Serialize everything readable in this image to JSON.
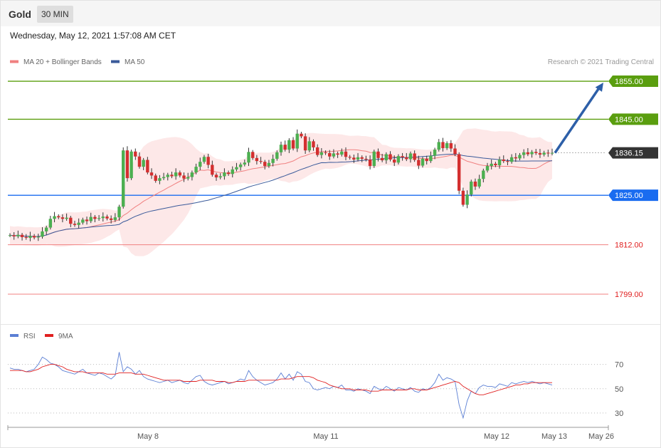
{
  "header": {
    "symbol": "Gold",
    "timeframe": "30 MIN",
    "datetime": "Wednesday, May 12, 2021 1:57:08 AM CET"
  },
  "legend": {
    "ma20": "MA 20 + Bollinger Bands",
    "ma50": "MA 50",
    "copyright": "Research © 2021 Trading Central",
    "ma20_color": "#f08080",
    "ma50_color": "#3a5a9a"
  },
  "rsi_legend": {
    "rsi": "RSI",
    "ma": "9MA",
    "rsi_color": "#5b7fd4",
    "ma_color": "#e02020"
  },
  "colors": {
    "up": "#4caf50",
    "down": "#d32f2f",
    "resistance": "#5a9e0f",
    "support": "#1a6cf0",
    "stop": "#e02020",
    "arrow": "#2d5fa8"
  },
  "chart_data": {
    "type": "candlestick",
    "x_ticks": [
      "May 8",
      "May 11",
      "May 12",
      "May 13",
      "May 26"
    ],
    "ylim": [
      1793,
      1858
    ],
    "levels": [
      {
        "label": "1855.00",
        "value": 1855.0,
        "kind": "resistance"
      },
      {
        "label": "1845.00",
        "value": 1845.0,
        "kind": "resistance"
      },
      {
        "label": "1836.15",
        "value": 1836.15,
        "kind": "current"
      },
      {
        "label": "1825.00",
        "value": 1825.0,
        "kind": "support"
      },
      {
        "label": "1812.00",
        "value": 1812.0,
        "kind": "stop"
      },
      {
        "label": "1799.00",
        "value": 1799.0,
        "kind": "stop"
      }
    ],
    "forecast_arrow": {
      "from": 1836.15,
      "to": 1855.0
    },
    "price_path": [
      1814.5,
      1814.2,
      1814.6,
      1814.0,
      1813.8,
      1814.3,
      1813.9,
      1814.1,
      1815.5,
      1816.5,
      1818.8,
      1819.5,
      1819.2,
      1818.8,
      1819.1,
      1817.5,
      1817.2,
      1817.8,
      1818.6,
      1818.2,
      1819.3,
      1818.8,
      1819.0,
      1819.4,
      1818.9,
      1818.5,
      1819.2,
      1822.0,
      1836.8,
      1829.5,
      1836.5,
      1835.2,
      1832.5,
      1834.3,
      1831.0,
      1830.2,
      1828.8,
      1829.5,
      1829.8,
      1830.4,
      1830.0,
      1831.0,
      1830.2,
      1829.4,
      1829.8,
      1831.0,
      1832.5,
      1833.8,
      1835.1,
      1833.0,
      1830.4,
      1829.7,
      1830.0,
      1831.0,
      1830.6,
      1831.8,
      1832.4,
      1833.1,
      1833.6,
      1836.4,
      1834.8,
      1834.0,
      1833.8,
      1832.7,
      1833.5,
      1834.6,
      1836.3,
      1838.3,
      1837.0,
      1839.5,
      1837.3,
      1841.2,
      1840.5,
      1836.8,
      1839.2,
      1837.6,
      1835.6,
      1836.3,
      1836.1,
      1835.2,
      1836.0,
      1835.7,
      1836.5,
      1835.1,
      1834.9,
      1834.4,
      1835.0,
      1834.6,
      1834.4,
      1832.7,
      1836.5,
      1834.8,
      1834.2,
      1835.8,
      1834.4,
      1833.6,
      1835.3,
      1835.0,
      1834.5,
      1836.0,
      1834.3,
      1832.8,
      1834.6,
      1834.0,
      1835.4,
      1837.0,
      1839.0,
      1837.4,
      1838.7,
      1837.3,
      1835.8,
      1826.2,
      1822.5,
      1825.2,
      1828.6,
      1827.3,
      1829.3,
      1831.5,
      1832.7,
      1833.3,
      1832.9,
      1834.4,
      1834.0,
      1833.8,
      1835.0,
      1834.7,
      1835.6,
      1836.3,
      1835.8,
      1836.4,
      1836.1,
      1835.7,
      1836.2,
      1836.0,
      1836.15
    ],
    "rsi": {
      "ticks": [
        30,
        50,
        70
      ],
      "ylim": [
        20,
        85
      ],
      "path": [
        67,
        66,
        66,
        65,
        64,
        65,
        66,
        70,
        76,
        74,
        71,
        70,
        68,
        65,
        64,
        63,
        62,
        64,
        66,
        63,
        62,
        61,
        63,
        62,
        60,
        58,
        61,
        80,
        64,
        68,
        66,
        62,
        65,
        60,
        58,
        57,
        56,
        55,
        56,
        57,
        55,
        56,
        57,
        55,
        54,
        57,
        60,
        61,
        56,
        54,
        53,
        54,
        55,
        56,
        54,
        55,
        56,
        58,
        57,
        65,
        60,
        57,
        55,
        53,
        54,
        55,
        58,
        63,
        58,
        62,
        57,
        64,
        62,
        56,
        55,
        50,
        49,
        50,
        51,
        50,
        52,
        51,
        53,
        49,
        49,
        48,
        50,
        49,
        48,
        46,
        52,
        50,
        49,
        52,
        50,
        48,
        51,
        50,
        49,
        51,
        48,
        47,
        50,
        49,
        51,
        55,
        62,
        57,
        59,
        58,
        56,
        37,
        26,
        40,
        48,
        46,
        51,
        53,
        52,
        52,
        51,
        54,
        53,
        52,
        55,
        54,
        55,
        56,
        55,
        56,
        55,
        54,
        55,
        54,
        53
      ],
      "ma": [
        65,
        65,
        65,
        65,
        64,
        64,
        65,
        66,
        68,
        69,
        70,
        70,
        69,
        68,
        66,
        65,
        64,
        64,
        64,
        63,
        63,
        63,
        63,
        63,
        62,
        62,
        62,
        63,
        63,
        63,
        63,
        62,
        62,
        62,
        61,
        60,
        59,
        58,
        57,
        57,
        57,
        57,
        57,
        56,
        56,
        56,
        56,
        57,
        57,
        57,
        57,
        56,
        56,
        56,
        55,
        55,
        56,
        56,
        56,
        57,
        57,
        57,
        57,
        57,
        57,
        57,
        57,
        58,
        58,
        58,
        59,
        60,
        60,
        60,
        60,
        59,
        57,
        56,
        55,
        53,
        52,
        51,
        50,
        50,
        50,
        49,
        49,
        49,
        49,
        48,
        48,
        48,
        49,
        49,
        49,
        49,
        49,
        49,
        49,
        50,
        50,
        49,
        49,
        49,
        50,
        51,
        52,
        53,
        54,
        55,
        56,
        55,
        52,
        50,
        48,
        46,
        45,
        45,
        46,
        47,
        48,
        49,
        50,
        51,
        52,
        53,
        53,
        54,
        54,
        55,
        55,
        55,
        55,
        55,
        55
      ]
    }
  }
}
